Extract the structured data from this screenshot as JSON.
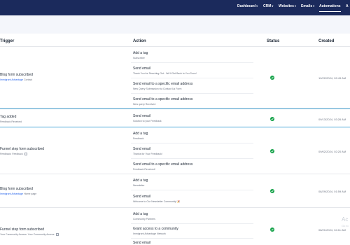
{
  "nav": {
    "items": [
      {
        "label": "Dashboard",
        "has_caret": true,
        "active": false
      },
      {
        "label": "CRM",
        "has_caret": true,
        "active": false
      },
      {
        "label": "Websites",
        "has_caret": true,
        "active": false
      },
      {
        "label": "Emails",
        "has_caret": true,
        "active": false
      },
      {
        "label": "Automations",
        "has_caret": false,
        "active": true
      },
      {
        "label": "A",
        "has_caret": false,
        "active": false
      }
    ]
  },
  "table": {
    "headers": {
      "trigger": "Trigger",
      "action": "Action",
      "status": "Status",
      "created": "Created"
    },
    "rows": [
      {
        "trigger_title": "Blog form subscribed",
        "trigger_link": "Immigrant Advantage",
        "trigger_detail": "Contact",
        "trigger_ext": false,
        "actions": [
          {
            "title": "Add a tag",
            "sub": "Subscriber"
          },
          {
            "title": "Send email",
            "sub": "Thank You for Reaching Out - We'll Get Back to You Soon!"
          },
          {
            "title": "Send email to a specific email address",
            "sub": "New Query Submission via Contact Us Form"
          },
          {
            "title": "Send email to a specific email address",
            "sub": "New query Received"
          }
        ],
        "status_icon": "check-circle-icon",
        "created": "10/22/2024, 02:49 AM"
      },
      {
        "trigger_title": "Tag added",
        "trigger_link": "",
        "trigger_detail": "Feedback Received",
        "trigger_ext": false,
        "actions": [
          {
            "title": "Send email",
            "sub": "Solution to your Feedback"
          }
        ],
        "status_icon": "check-circle-icon",
        "created": "09/13/2024, 03:26 AM"
      },
      {
        "trigger_title": "Funnel step form subscribed",
        "trigger_link": "",
        "trigger_detail": "Feedback: Feedback",
        "trigger_ext": true,
        "actions": [
          {
            "title": "Add a tag",
            "sub": "Feedback"
          },
          {
            "title": "Send email",
            "sub": "Thanks for Your Feedback!"
          },
          {
            "title": "Send email to a specific email address",
            "sub": "Feedback Received!"
          }
        ],
        "status_icon": "check-circle-icon",
        "created": "09/02/2024, 02:20 AM"
      },
      {
        "trigger_title": "Blog form subscribed",
        "trigger_link": "Immigrant Advantage",
        "trigger_detail": "Home page",
        "trigger_ext": false,
        "actions": [
          {
            "title": "Add a tag",
            "sub": "Newsletter"
          },
          {
            "title": "Send email",
            "sub": "Welcome to Our Newsletter Community! 🎉"
          }
        ],
        "status_icon": "check-circle-icon",
        "created": "08/29/2024, 01:59 AM"
      },
      {
        "trigger_title": "Funnel step form subscribed",
        "trigger_link": "",
        "trigger_detail": "Your Community Access: Your Community Access",
        "trigger_ext": true,
        "actions": [
          {
            "title": "Add a tag",
            "sub": "Community Partners"
          },
          {
            "title": "Grant access to a community",
            "sub": "Immigrant Advantage Network"
          },
          {
            "title": "Send email",
            "sub": ""
          }
        ],
        "status_icon": "check-circle-icon",
        "created": "08/21/2024, 04:11 AM"
      }
    ]
  },
  "watermark": {
    "title": "Ac",
    "sub": "Go to"
  }
}
